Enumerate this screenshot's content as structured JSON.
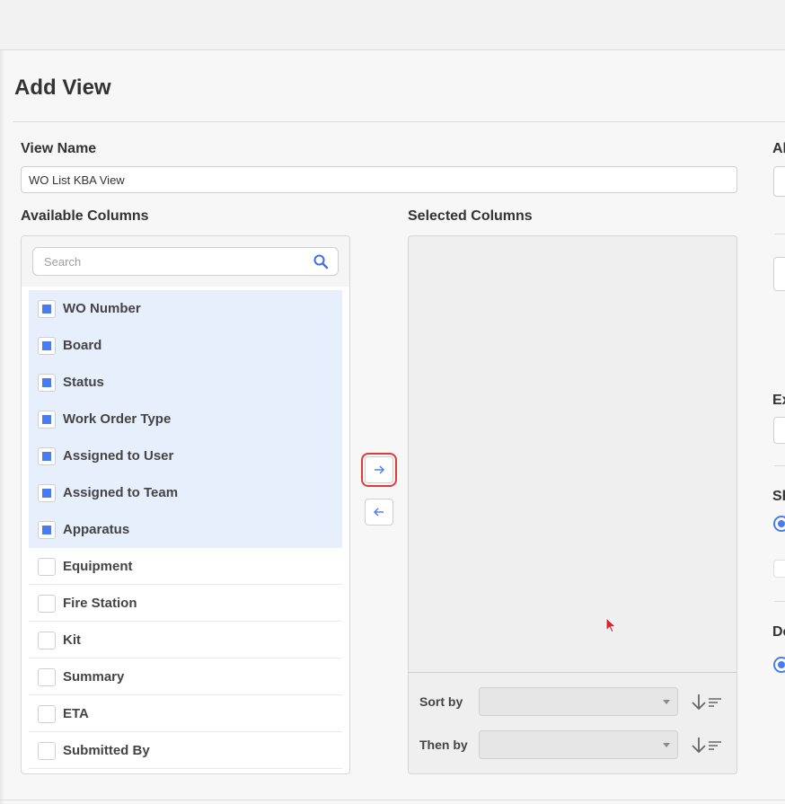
{
  "page": {
    "title": "Add View"
  },
  "view_name": {
    "label": "View Name",
    "value": "WO List KBA View"
  },
  "available": {
    "label": "Available Columns",
    "search_placeholder": "Search",
    "items": [
      {
        "label": "WO Number",
        "checked": true
      },
      {
        "label": "Board",
        "checked": true
      },
      {
        "label": "Status",
        "checked": true
      },
      {
        "label": "Work Order Type",
        "checked": true
      },
      {
        "label": "Assigned to User",
        "checked": true
      },
      {
        "label": "Assigned to Team",
        "checked": true
      },
      {
        "label": "Apparatus",
        "checked": true
      },
      {
        "label": "Equipment",
        "checked": false
      },
      {
        "label": "Fire Station",
        "checked": false
      },
      {
        "label": "Kit",
        "checked": false
      },
      {
        "label": "Summary",
        "checked": false
      },
      {
        "label": "ETA",
        "checked": false
      },
      {
        "label": "Submitted By",
        "checked": false
      }
    ]
  },
  "selected": {
    "label": "Selected Columns",
    "sort_by_label": "Sort by",
    "then_by_label": "Then by",
    "sort_by_value": "",
    "then_by_value": ""
  },
  "right_fragments": [
    "Al",
    "Ex",
    "Sh",
    "De"
  ],
  "icons": {
    "search": "search-icon",
    "move_right": "arrow-right-icon",
    "move_left": "arrow-left-icon",
    "sort_desc": "sort-descending-icon",
    "cursor": "mouse-cursor-icon"
  },
  "colors": {
    "accent": "#4a7cf0",
    "selected_row": "#e6effb",
    "highlight": "#e03b3b"
  }
}
